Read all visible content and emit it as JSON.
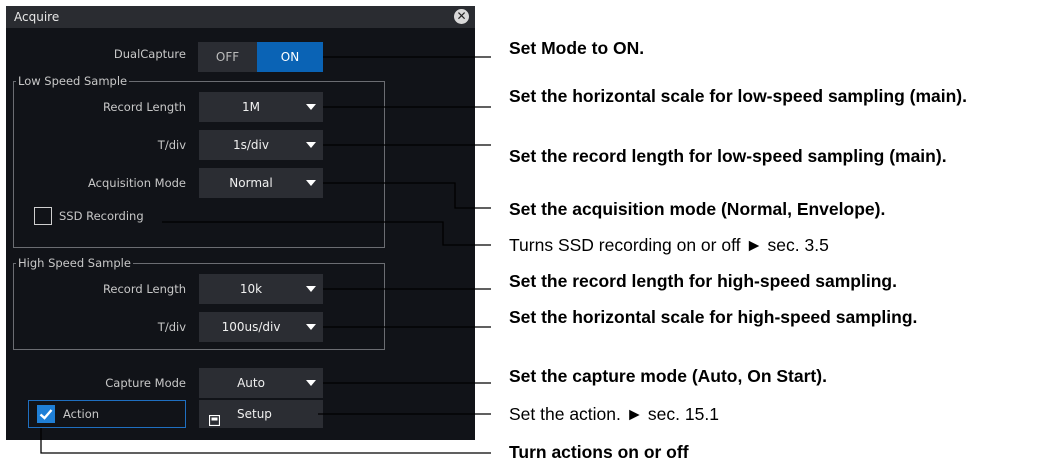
{
  "dialog": {
    "title": "Acquire",
    "close_symbol": "✕"
  },
  "dual_capture": {
    "label": "DualCapture",
    "off_label": "OFF",
    "on_label": "ON",
    "selected": "ON"
  },
  "low_speed": {
    "group_title": "Low Speed Sample",
    "record_length_label": "Record Length",
    "record_length_value": "1M",
    "tdiv_label": "T/div",
    "tdiv_value": "1s/div",
    "acq_mode_label": "Acquisition Mode",
    "acq_mode_value": "Normal",
    "ssd_label": "SSD Recording",
    "ssd_checked": false
  },
  "high_speed": {
    "group_title": "High Speed Sample",
    "record_length_label": "Record Length",
    "record_length_value": "10k",
    "tdiv_label": "T/div",
    "tdiv_value": "100us/div"
  },
  "capture_mode": {
    "label": "Capture Mode",
    "value": "Auto"
  },
  "action": {
    "label": "Action",
    "checked": true,
    "setup_label": "Setup"
  },
  "annotations": {
    "mode_on": "Set Mode to ON.",
    "low_hscale": "Set the horizontal scale for low-speed sampling (main).",
    "low_reclen": "Set the record length for low-speed sampling (main).",
    "acq_mode": "Set the acquisition mode (Normal, Envelope).",
    "ssd": "Turns SSD recording on or off ► sec. 3.5",
    "high_reclen": "Set the record length for high-speed sampling.",
    "high_hscale": "Set the horizontal scale for high-speed sampling.",
    "capture_mode": "Set the capture mode (Auto, On Start).",
    "action_set": "Set the action. ► sec. 15.1",
    "action_onoff": "Turn actions on or off"
  },
  "colors": {
    "panel_bg": "#111318",
    "control_bg": "#2b2d33",
    "accent_blue": "#0a63b5",
    "text": "#c8c8c8"
  }
}
